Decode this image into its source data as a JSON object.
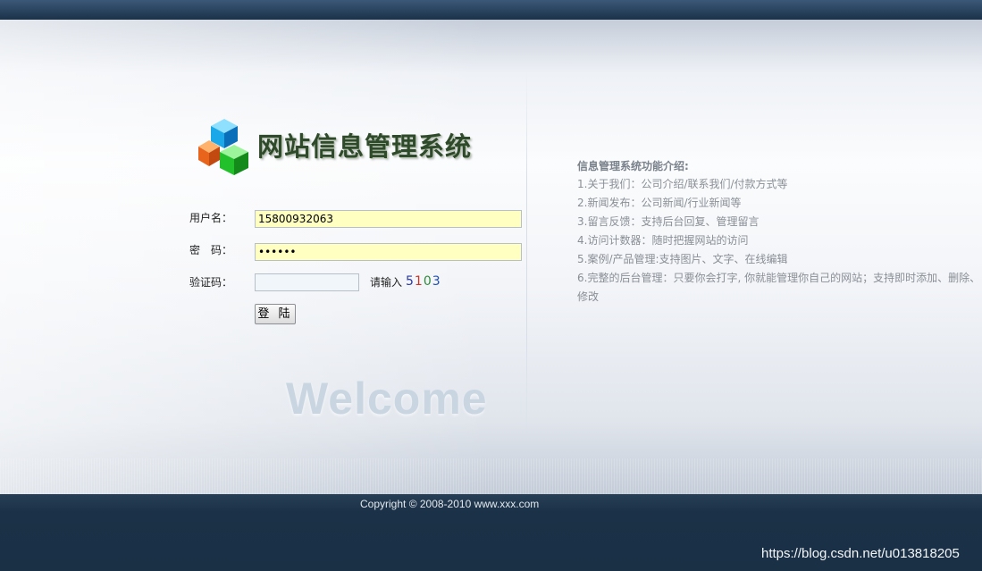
{
  "header": {
    "logo_icon": "stacked-cubes-icon",
    "title": "网站信息管理系统"
  },
  "login": {
    "username_label": "用户名：",
    "username_value": "15800932063",
    "password_label": "密　码：",
    "password_value": "abcdef",
    "captcha_label": "验证码：",
    "captcha_value": "",
    "captcha_prompt": "请输入",
    "captcha_digits": [
      {
        "char": "5",
        "color": "#2a3aa0"
      },
      {
        "char": "1",
        "color": "#c0392b"
      },
      {
        "char": "0",
        "color": "#2f8a3a"
      },
      {
        "char": "3",
        "color": "#1f4fb0"
      }
    ],
    "submit_label": "登 陆"
  },
  "welcome_text": "Welcome",
  "intro": {
    "title": "信息管理系统功能介绍:",
    "items": [
      "1.关于我们：公司介绍/联系我们/付款方式等",
      "2.新闻发布：公司新闻/行业新闻等",
      "3.留言反馈：支持后台回复、管理留言",
      "4.访问计数器：随时把握网站的访问",
      "5.案例/产品管理:支持图片、文字、在线编辑",
      "6.完整的后台管理：只要你会打字, 你就能管理你自己的网站；支持即时添加、删除、修改"
    ]
  },
  "footer": {
    "copyright": "Copyright © 2008-2010 www.xxx.com",
    "watermark": "https://blog.csdn.net/u013818205"
  },
  "colors": {
    "topbar": "#1b3249",
    "footer": "#1a3045",
    "input_yellow": "#ffffc2",
    "title_green": "#2f4a2a"
  }
}
